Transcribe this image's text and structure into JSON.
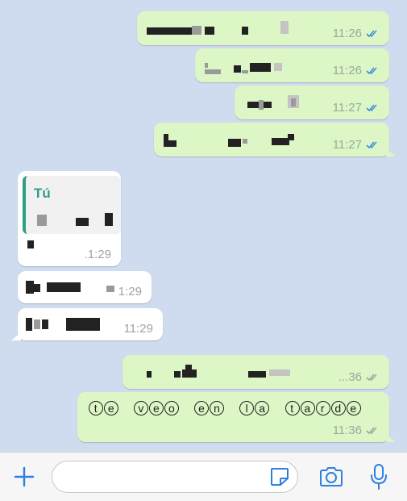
{
  "colors": {
    "chat_background": "#cfdbef",
    "outgoing_bubble": "#dcf7c5",
    "incoming_bubble": "#ffffff",
    "accent": "#2f9e86",
    "read_ticks": "#3e8ede",
    "icon_blue": "#2f7fe0"
  },
  "messages": [
    {
      "direction": "outgoing",
      "text_redacted": true,
      "time": "11:26",
      "status": "read"
    },
    {
      "direction": "outgoing",
      "text_redacted": true,
      "time": "11:26",
      "status": "read"
    },
    {
      "direction": "outgoing",
      "text_redacted": true,
      "time": "11:27",
      "status": "read"
    },
    {
      "direction": "outgoing",
      "text_redacted": true,
      "time": "11:27",
      "status": "read"
    },
    {
      "direction": "incoming",
      "reply_to": {
        "name": "Tú",
        "text_redacted": true
      },
      "text_redacted": true,
      "time": ".1:29"
    },
    {
      "direction": "incoming",
      "text_redacted": true,
      "time": "1:29"
    },
    {
      "direction": "incoming",
      "text_redacted": true,
      "time": "11:29"
    },
    {
      "direction": "outgoing",
      "text_redacted": true,
      "time": "...36",
      "status": "delivered"
    },
    {
      "direction": "outgoing",
      "text": "te veo en la tarde",
      "text_chars": [
        "t",
        "e",
        "v",
        "e",
        "o",
        "e",
        "n",
        "l",
        "a",
        "t",
        "a",
        "r",
        "d",
        "e"
      ],
      "time": "11:36",
      "status": "delivered"
    }
  ],
  "input_bar": {
    "placeholder": "",
    "icons": [
      "plus-icon",
      "sticker-icon",
      "camera-icon",
      "microphone-icon"
    ]
  }
}
